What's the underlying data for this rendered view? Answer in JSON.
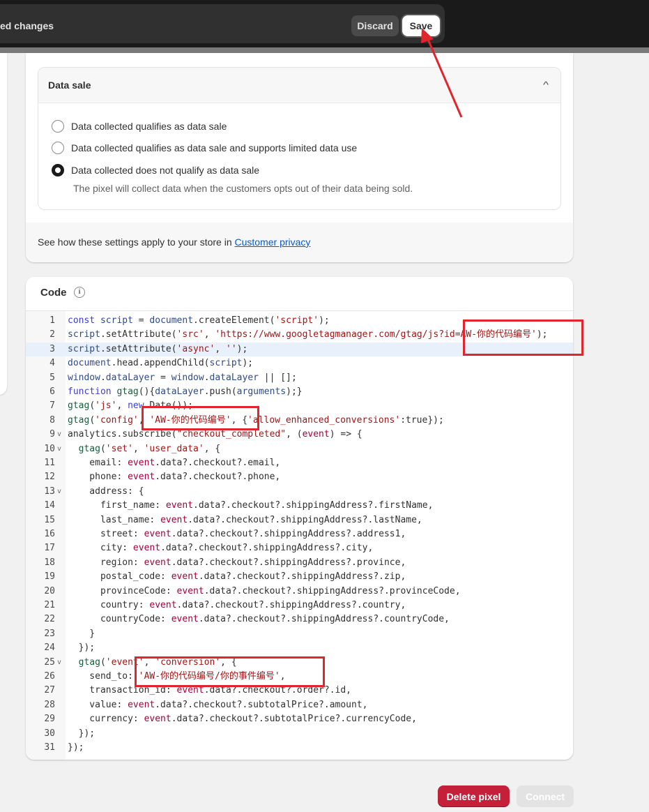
{
  "save_bar": {
    "message": "ed changes",
    "discard_label": "Discard",
    "save_label": "Save"
  },
  "data_sale": {
    "title": "Data sale",
    "options": [
      {
        "label": "Data collected qualifies as data sale",
        "selected": false
      },
      {
        "label": "Data collected qualifies as data sale and supports limited data use",
        "selected": false
      },
      {
        "label": "Data collected does not qualify as data sale",
        "selected": true
      }
    ],
    "help_text": "The pixel will collect data when the customers opts out of their data being sold.",
    "footer_text": "See how these settings apply to your store in ",
    "footer_link": "Customer privacy"
  },
  "code_section": {
    "title": "Code",
    "active_line": 3,
    "lines": [
      {
        "n": "1",
        "fold": false,
        "text": "const script = document.createElement('script');"
      },
      {
        "n": "2",
        "fold": false,
        "text": "script.setAttribute('src', 'https://www.googletagmanager.com/gtag/js?id=AW-你的代码编号');"
      },
      {
        "n": "3",
        "fold": false,
        "text": "script.setAttribute('async', '');"
      },
      {
        "n": "4",
        "fold": false,
        "text": "document.head.appendChild(script);"
      },
      {
        "n": "5",
        "fold": false,
        "text": "window.dataLayer = window.dataLayer || [];"
      },
      {
        "n": "6",
        "fold": false,
        "text": "function gtag(){dataLayer.push(arguments);}"
      },
      {
        "n": "7",
        "fold": false,
        "text": "gtag('js', new Date());"
      },
      {
        "n": "8",
        "fold": false,
        "text": "gtag('config', 'AW-你的代码编号', {'allow_enhanced_conversions':true});"
      },
      {
        "n": "9",
        "fold": true,
        "text": "analytics.subscribe(\"checkout_completed\", (event) => {"
      },
      {
        "n": "10",
        "fold": true,
        "text": "  gtag('set', 'user_data', {"
      },
      {
        "n": "11",
        "fold": false,
        "text": "    email: event.data?.checkout?.email,"
      },
      {
        "n": "12",
        "fold": false,
        "text": "    phone: event.data?.checkout?.phone,"
      },
      {
        "n": "13",
        "fold": true,
        "text": "    address: {"
      },
      {
        "n": "14",
        "fold": false,
        "text": "      first_name: event.data?.checkout?.shippingAddress?.firstName,"
      },
      {
        "n": "15",
        "fold": false,
        "text": "      last_name: event.data?.checkout?.shippingAddress?.lastName,"
      },
      {
        "n": "16",
        "fold": false,
        "text": "      street: event.data?.checkout?.shippingAddress?.address1,"
      },
      {
        "n": "17",
        "fold": false,
        "text": "      city: event.data?.checkout?.shippingAddress?.city,"
      },
      {
        "n": "18",
        "fold": false,
        "text": "      region: event.data?.checkout?.shippingAddress?.province,"
      },
      {
        "n": "19",
        "fold": false,
        "text": "      postal_code: event.data?.checkout?.shippingAddress?.zip,"
      },
      {
        "n": "20",
        "fold": false,
        "text": "      provinceCode: event.data?.checkout?.shippingAddress?.provinceCode,"
      },
      {
        "n": "21",
        "fold": false,
        "text": "      country: event.data?.checkout?.shippingAddress?.country,"
      },
      {
        "n": "22",
        "fold": false,
        "text": "      countryCode: event.data?.checkout?.shippingAddress?.countryCode,"
      },
      {
        "n": "23",
        "fold": false,
        "text": "    }"
      },
      {
        "n": "24",
        "fold": false,
        "text": "  });"
      },
      {
        "n": "25",
        "fold": true,
        "text": "  gtag('event', 'conversion', {"
      },
      {
        "n": "26",
        "fold": false,
        "text": "    send_to: 'AW-你的代码编号/你的事件编号',"
      },
      {
        "n": "27",
        "fold": false,
        "text": "    transaction_id: event.data?.checkout?.order?.id,"
      },
      {
        "n": "28",
        "fold": false,
        "text": "    value: event.data?.checkout?.subtotalPrice?.amount,"
      },
      {
        "n": "29",
        "fold": false,
        "text": "    currency: event.data?.checkout?.subtotalPrice?.currencyCode,"
      },
      {
        "n": "30",
        "fold": false,
        "text": "  });"
      },
      {
        "n": "31",
        "fold": false,
        "text": "});"
      }
    ]
  },
  "actions": {
    "delete_label": "Delete pixel",
    "connect_label": "Connect"
  },
  "colors": {
    "annotation_red": "#e0252c",
    "delete_red": "#c5203a"
  }
}
